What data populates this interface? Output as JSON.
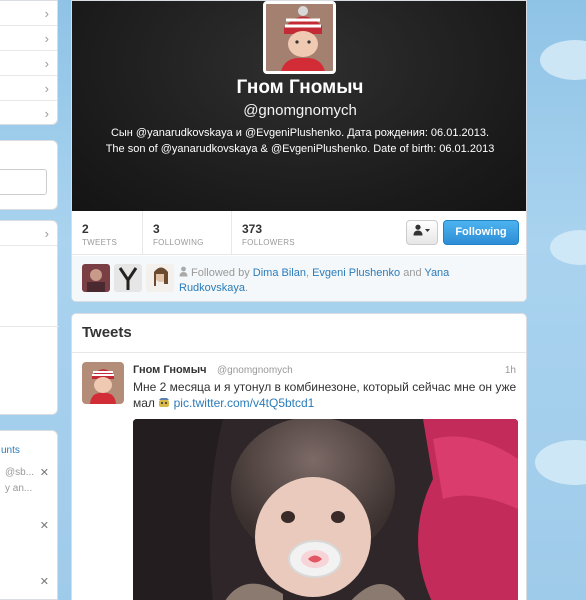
{
  "profile": {
    "name": "Гном Гномыч",
    "handle": "@gnomgnomych",
    "bio": "Сын @yanarudkovskaya и @EvgeniPlushenko. Дата рождения: 06.01.2013. The son of @yanarudkovskaya & @EvgeniPlushenko. Date of birth: 06.01.2013"
  },
  "stats": {
    "tweets": {
      "count": "2",
      "label": "TWEETS"
    },
    "following": {
      "count": "3",
      "label": "FOLLOWING"
    },
    "followers": {
      "count": "373",
      "label": "FOLLOWERS"
    }
  },
  "actions": {
    "user_dropdown_icon": "user-icon",
    "follow_label": "Following"
  },
  "followed_by": {
    "prefix": "Followed by",
    "user1": "Dima Bilan",
    "sep": ",",
    "user2": "Evgeni Plushenko",
    "and": "and",
    "user3": "Yana Rudkovskaya",
    "end": "."
  },
  "tweets": {
    "title": "Tweets",
    "items": [
      {
        "name": "Гном Гномыч",
        "handle": "@gnomgnomych",
        "time": "1h",
        "text": "Мне 2 месяца и я утонул в комбинезоне, который сейчас мне он уже мал",
        "link": "pic.twitter.com/v4tQ5btcd1"
      }
    ]
  },
  "sidebar": {
    "accounts_fragment": "unts",
    "suggest1": "@sb...",
    "suggest2": "y an...",
    "close": "✕"
  },
  "colors": {
    "accent": "#2b7bb9",
    "follow_button": "#2d8dd6",
    "header_bg": "#1b1b1b"
  }
}
